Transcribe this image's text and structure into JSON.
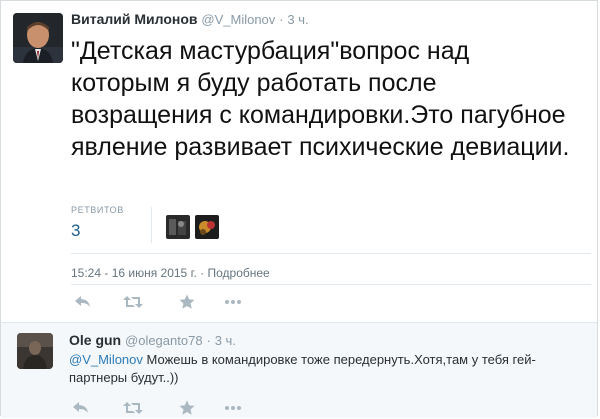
{
  "tweet": {
    "fullname": "Виталий Милонов",
    "username": "@V_Milonov",
    "dot": "·",
    "time": "3 ч.",
    "text": "\"Детская мастурбация\"вопрос над которым я буду работать после возращения с командировки.Это пагубное явление развивает психические девиации.",
    "retweets_label": "РЕТВИТОВ",
    "retweets_count": "3",
    "datetime": "15:24 - 16 июня 2015 г.",
    "detail_sep": "·",
    "details_link": "Подробнее",
    "actions": [
      {
        "name": "reply-icon"
      },
      {
        "name": "retweet-icon"
      },
      {
        "name": "favorite-icon"
      },
      {
        "name": "more-icon"
      }
    ]
  },
  "reply": {
    "fullname": "Ole gun",
    "username": "@oleganto78",
    "dot": "·",
    "time": "3 ч.",
    "mention": "@V_Milonov",
    "text": " Можешь в командировке тоже передернуть.Хотя,там у тебя гей-партнеры будут..))"
  },
  "colors": {
    "link": "#2b7bb9",
    "muted": "#8899a6",
    "reply_bg": "#f5f8fa",
    "action_icon": "#aab8c2"
  }
}
